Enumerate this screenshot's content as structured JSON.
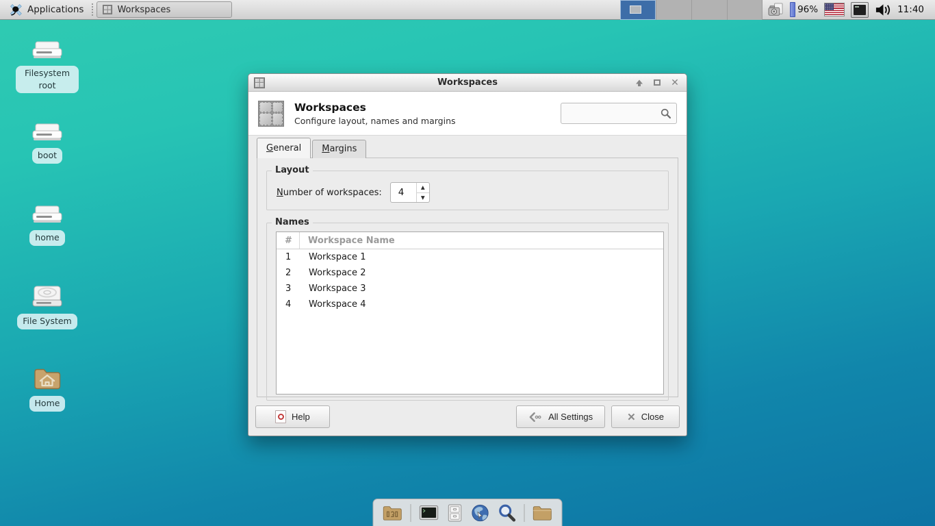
{
  "panel": {
    "applications_label": "Applications",
    "task_button_label": "Workspaces",
    "pager": {
      "workspace_count": 4,
      "active_index": 0
    },
    "battery_percent": "96%",
    "clock": "11:40",
    "tray_icons": [
      "screenshot-camera-icon",
      "battery-indicator",
      "us-flag-icon",
      "keyboard-layout-icon",
      "volume-icon"
    ]
  },
  "desktop": {
    "icons": [
      {
        "label": "Filesystem root",
        "icon": "drive-icon"
      },
      {
        "label": "boot",
        "icon": "drive-icon"
      },
      {
        "label": "home",
        "icon": "drive-icon"
      },
      {
        "label": "File System",
        "icon": "disc-drive-icon"
      },
      {
        "label": "Home",
        "icon": "home-folder-icon"
      }
    ]
  },
  "dialog": {
    "window_title": "Workspaces",
    "window_controls": [
      "shade-up-icon",
      "maximize-icon",
      "close-icon"
    ],
    "header": {
      "title": "Workspaces",
      "subtitle": "Configure layout, names and margins",
      "search_value": ""
    },
    "tabs": [
      {
        "label": "General",
        "active": true
      },
      {
        "label": "Margins",
        "active": false
      }
    ],
    "layout_group": {
      "title": "Layout",
      "spin_label": "Number of workspaces:",
      "spin_value": "4"
    },
    "names_group": {
      "title": "Names",
      "columns": {
        "num": "#",
        "name": "Workspace Name"
      },
      "rows": [
        {
          "num": "1",
          "name": "Workspace 1"
        },
        {
          "num": "2",
          "name": "Workspace 2"
        },
        {
          "num": "3",
          "name": "Workspace 3"
        },
        {
          "num": "4",
          "name": "Workspace 4"
        }
      ]
    },
    "buttons": {
      "help": "Help",
      "all_settings": "All Settings",
      "close": "Close"
    }
  },
  "dock": {
    "items": [
      "directory-menu-icon",
      "terminal-icon",
      "file-manager-icon",
      "web-browser-icon",
      "application-finder-icon",
      "folder-icon"
    ]
  },
  "colors": {
    "desktop_gradient_top": "#30cbb2",
    "desktop_gradient_bottom": "#0d73a4",
    "panel_bg": "#d8d8d8",
    "active_workspace_blue": "#3d6da8",
    "battery_fill_blue": "#5f76d2",
    "dialog_bg": "#ececec",
    "flag_red": "#b22234",
    "flag_blue": "#3c3b6e"
  }
}
